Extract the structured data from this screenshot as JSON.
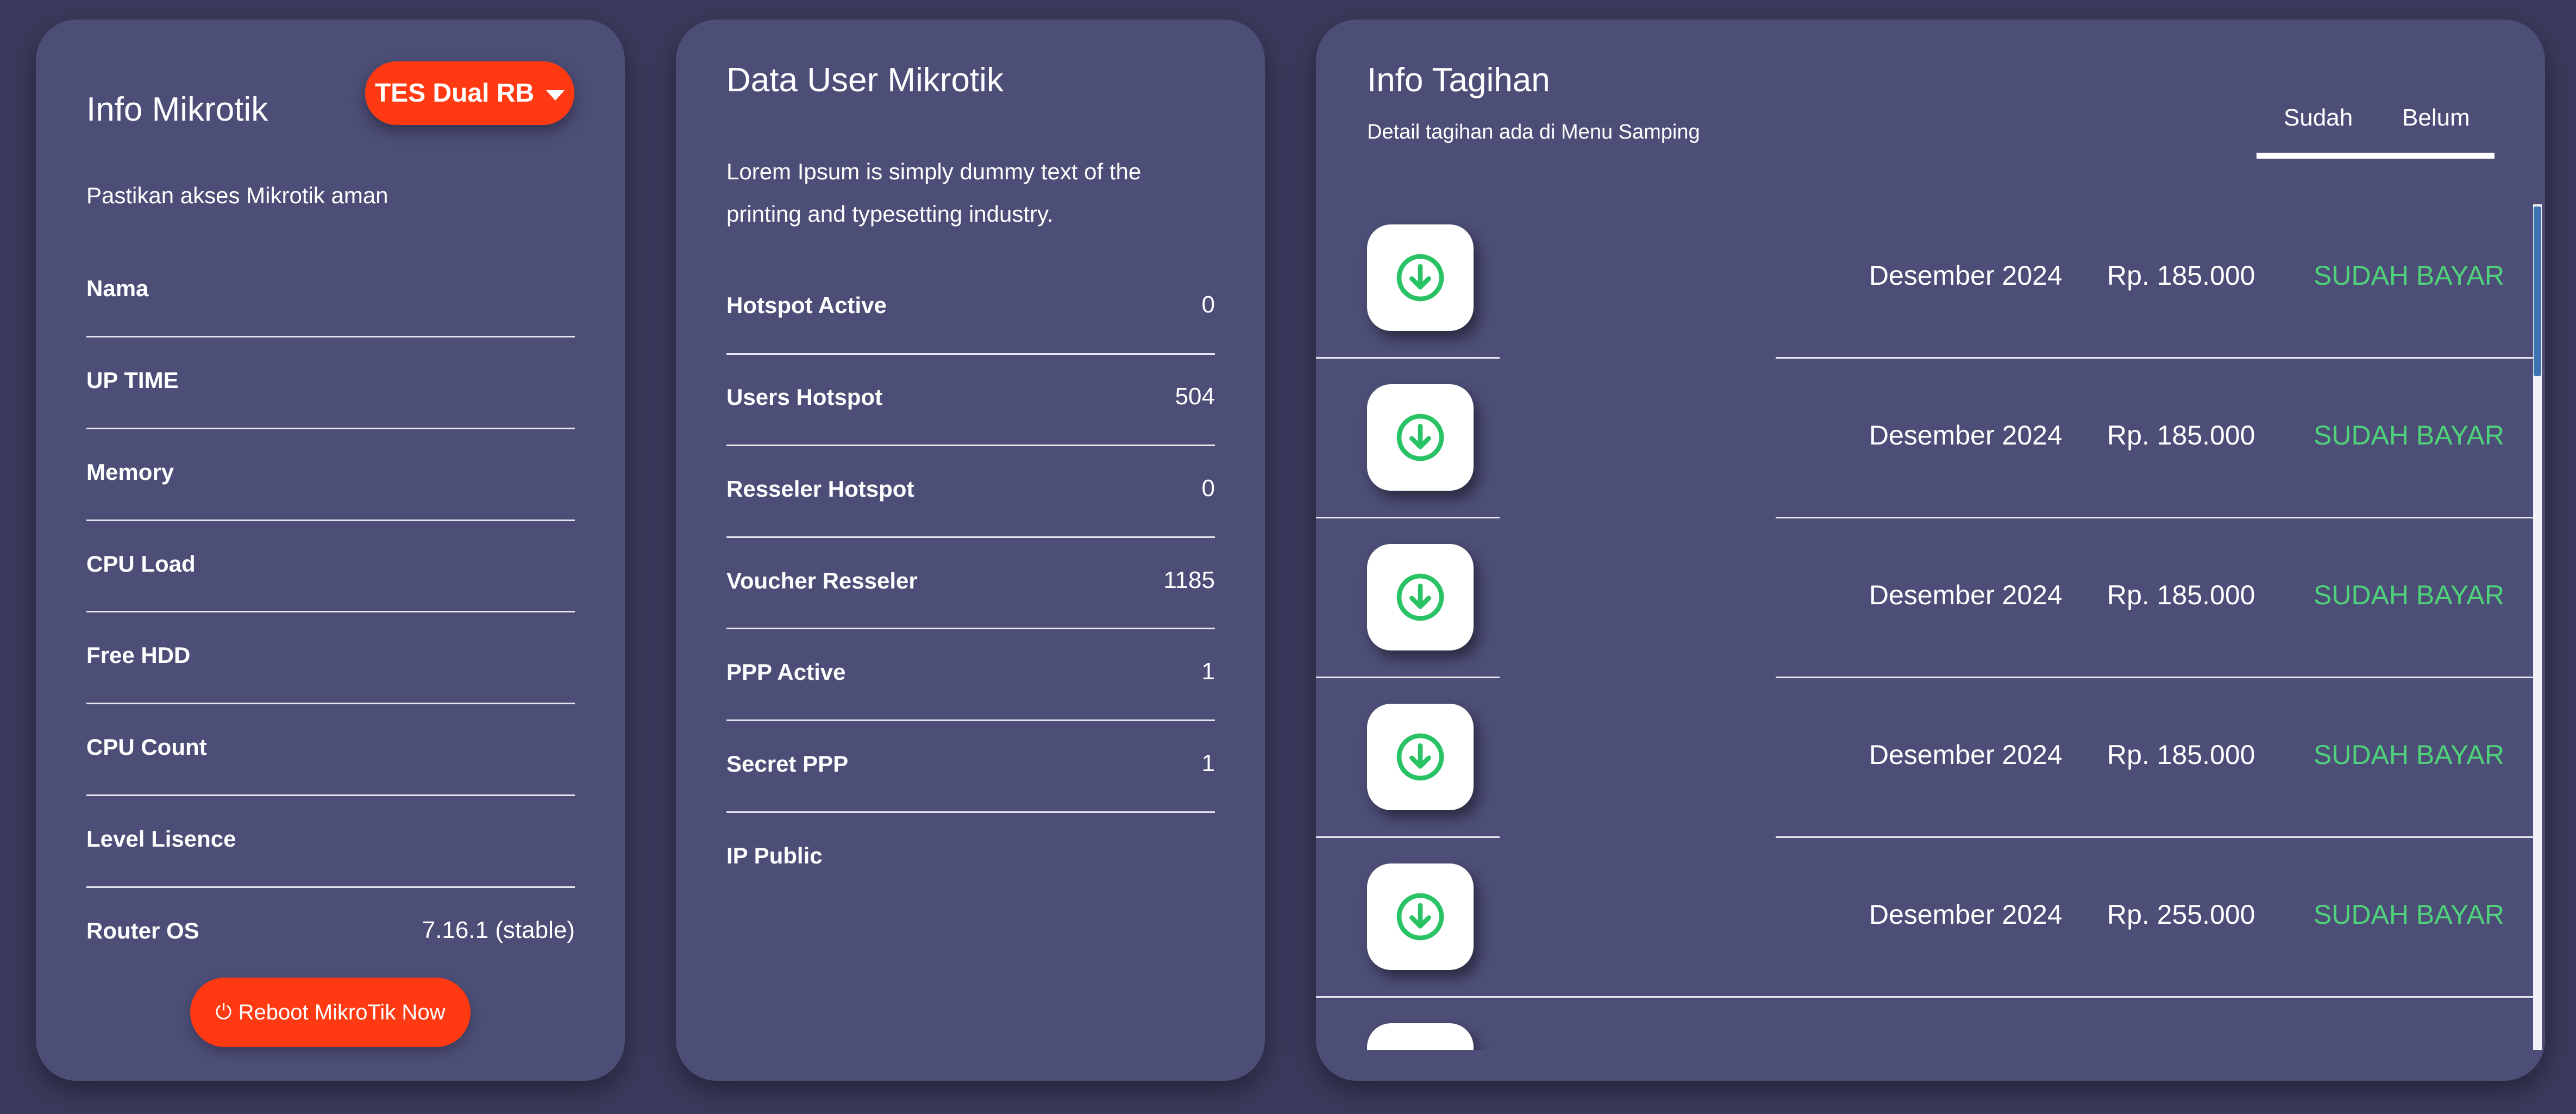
{
  "info_mikrotik": {
    "title": "Info Mikrotik",
    "router_select": "TES Dual RB",
    "subtitle": "Pastikan akses Mikrotik aman",
    "rows": [
      {
        "label": "Nama",
        "value": ""
      },
      {
        "label": "UP TIME",
        "value": ""
      },
      {
        "label": "Memory",
        "value": ""
      },
      {
        "label": "CPU Load",
        "value": ""
      },
      {
        "label": "Free HDD",
        "value": ""
      },
      {
        "label": "CPU Count",
        "value": ""
      },
      {
        "label": "Level Lisence",
        "value": ""
      },
      {
        "label": "Router OS",
        "value": "7.16.1 (stable)"
      }
    ],
    "reboot_label": "Reboot MikroTik Now",
    "reboot_icon": "power-icon"
  },
  "data_user": {
    "title": "Data User Mikrotik",
    "description_line1": "Lorem Ipsum is simply dummy text of the",
    "description_line2": "printing and typesetting industry.",
    "rows": [
      {
        "label": "Hotspot Active",
        "value": "0"
      },
      {
        "label": "Users Hotspot",
        "value": "504"
      },
      {
        "label": "Resseler Hotspot",
        "value": "0"
      },
      {
        "label": "Voucher Resseler",
        "value": "1185"
      },
      {
        "label": "PPP Active",
        "value": "1"
      },
      {
        "label": "Secret PPP",
        "value": "1"
      },
      {
        "label": "IP Public",
        "value": ""
      }
    ]
  },
  "info_tagihan": {
    "title": "Info Tagihan",
    "subtitle": "Detail tagihan ada di Menu Samping",
    "tabs": [
      "Sudah",
      "Belum"
    ],
    "active_tab": "Sudah",
    "status_color": "#4fd27a",
    "bills": [
      {
        "period": "Desember 2024",
        "amount": "Rp. 185.000",
        "status": "SUDAH BAYAR",
        "icon": "download-icon"
      },
      {
        "period": "Desember 2024",
        "amount": "Rp. 185.000",
        "status": "SUDAH BAYAR",
        "icon": "download-icon"
      },
      {
        "period": "Desember 2024",
        "amount": "Rp. 185.000",
        "status": "SUDAH BAYAR",
        "icon": "download-icon"
      },
      {
        "period": "Desember 2024",
        "amount": "Rp. 185.000",
        "status": "SUDAH BAYAR",
        "icon": "download-icon"
      },
      {
        "period": "Desember 2024",
        "amount": "Rp. 255.000",
        "status": "SUDAH BAYAR",
        "icon": "download-icon"
      },
      {
        "period": "",
        "amount": "",
        "status": "",
        "icon": "download-icon"
      }
    ]
  },
  "colors": {
    "background": "#3a3a5c",
    "card": "#4d4e77",
    "accent": "#ff3a12",
    "paid_status": "#4fd27a",
    "scroll_thumb": "#3e73b3"
  }
}
